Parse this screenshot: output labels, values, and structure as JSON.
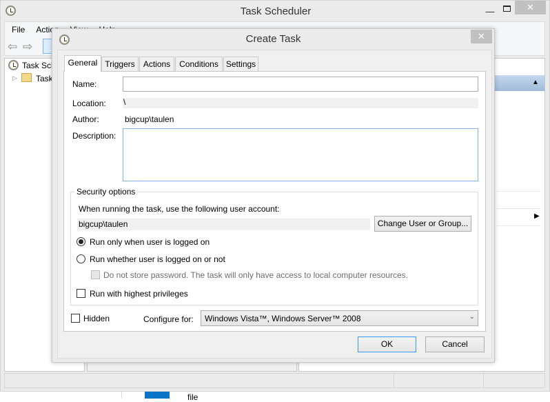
{
  "main_window": {
    "title": "Task Scheduler",
    "minimize_icon": "minimize-icon",
    "maximize_icon": "maximize-icon",
    "close_icon": "close-icon"
  },
  "menu": [
    "File",
    "Action",
    "View",
    "Help"
  ],
  "tree": {
    "root": "Task Sch",
    "child": "Task"
  },
  "taskbar_text": "file",
  "dialog": {
    "title": "Create Task",
    "tabs": [
      "General",
      "Triggers",
      "Actions",
      "Conditions",
      "Settings"
    ],
    "active_tab": "General",
    "name_label": "Name:",
    "name_value": "",
    "location_label": "Location:",
    "location_value": "\\",
    "author_label": "Author:",
    "author_value": "bigcup\\taulen",
    "description_label": "Description:",
    "description_value": "",
    "security": {
      "legend": "Security options",
      "account_prompt": "When running the task, use the following user account:",
      "account": "bigcup\\taulen",
      "change_button": "Change User or Group...",
      "radio_logged_on": "Run only when user is logged on",
      "radio_whether": "Run whether user is logged on or not",
      "selected_radio": "Run only when user is logged on",
      "no_store_password": "Do not store password.  The task will only have access to local computer resources.",
      "highest_privileges": "Run with highest privileges",
      "highest_privileges_checked": false
    },
    "hidden_label": "Hidden",
    "hidden_checked": false,
    "configure_label": "Configure for:",
    "configure_value": "Windows Vista™, Windows Server™ 2008",
    "ok": "OK",
    "cancel": "Cancel"
  },
  "colors": {
    "accent": "#3399ff",
    "header_blue": "#b7cde6"
  }
}
